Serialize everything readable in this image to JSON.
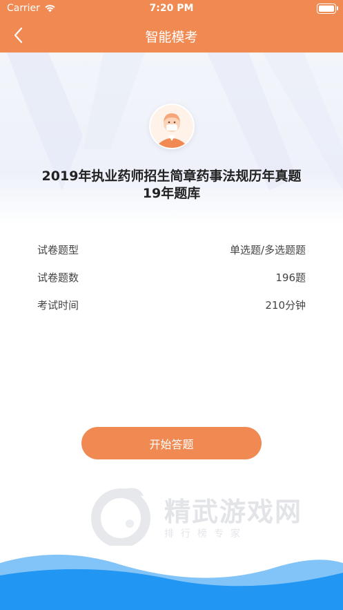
{
  "status_bar": {
    "carrier": "Carrier",
    "time": "7:20 PM"
  },
  "nav": {
    "title": "智能模考"
  },
  "paper": {
    "title_line1": "2019年执业药师招生简章药事法规历年真题",
    "title_line2": "19年题库"
  },
  "info": [
    {
      "label": "试卷题型",
      "value": "单选题/多选题题"
    },
    {
      "label": "试卷题数",
      "value": "196题"
    },
    {
      "label": "考试时间",
      "value": "210分钟"
    }
  ],
  "actions": {
    "start_label": "开始答题"
  },
  "watermark": {
    "text": "精武游戏网",
    "sub": "排行榜专家"
  },
  "colors": {
    "accent": "#f08a52",
    "wave_dark": "#2196f3",
    "wave_light": "#64b5f6"
  }
}
